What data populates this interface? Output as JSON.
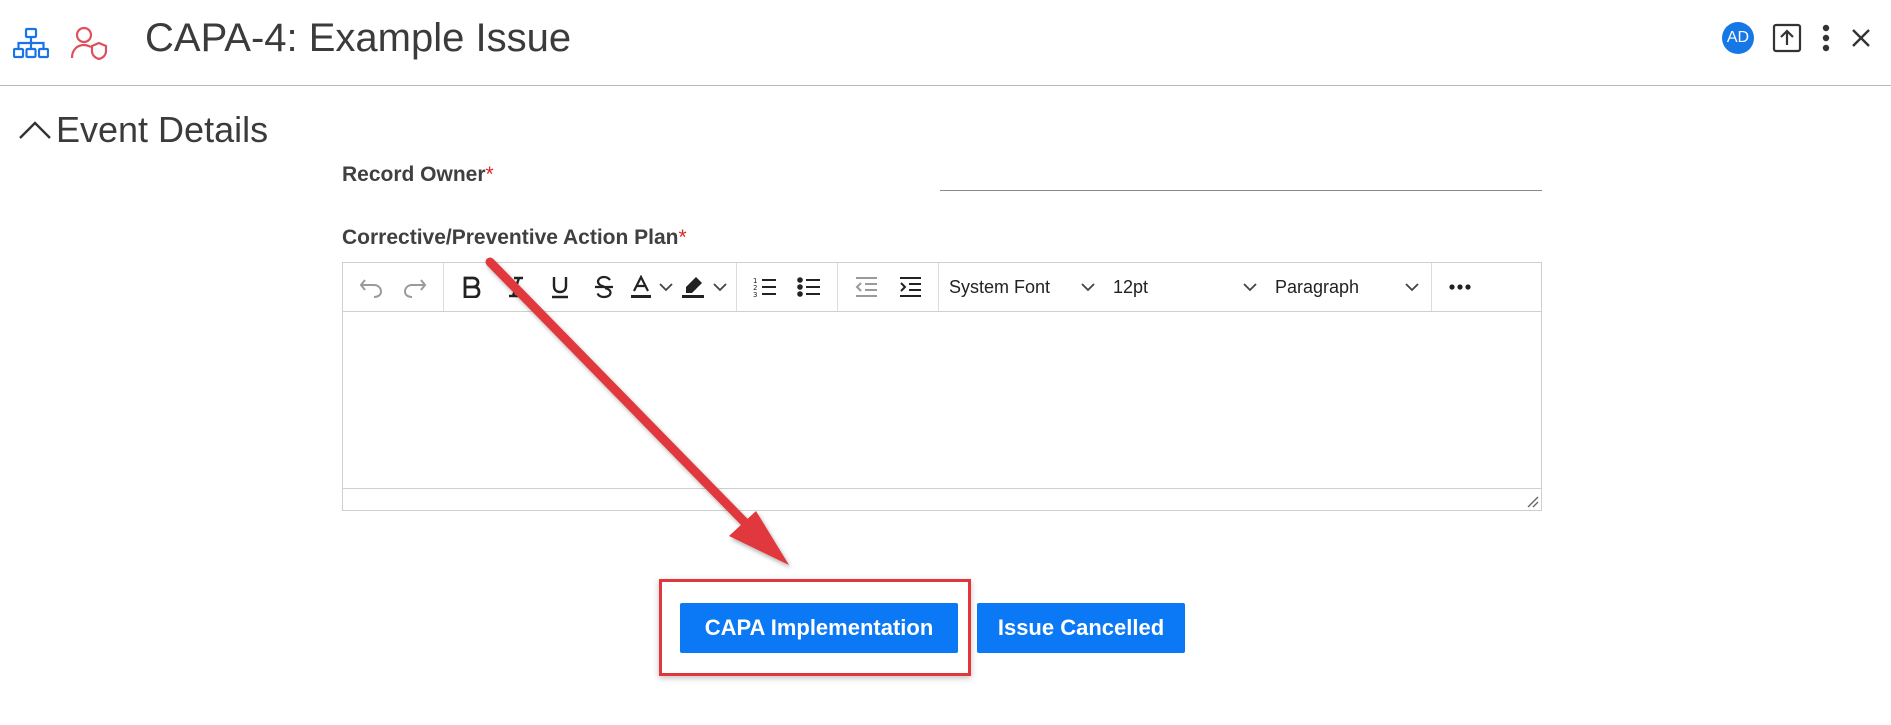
{
  "header": {
    "title": "CAPA-4: Example Issue",
    "avatar_initials": "AD",
    "icons": [
      "hierarchy-icon",
      "user-shield-icon",
      "export-icon",
      "more-vertical-icon",
      "close-icon"
    ]
  },
  "section": {
    "label": "Event Details",
    "expanded": true
  },
  "fields": {
    "record_owner_label": "Record Owner",
    "record_owner_required_mark": "*",
    "action_plan_label": "Corrective/Preventive Action Plan",
    "action_plan_required_mark": "*"
  },
  "editor": {
    "font_family": "System Font",
    "font_size": "12pt",
    "block_format": "Paragraph",
    "content": ""
  },
  "actions": {
    "capa_implementation_label": "CAPA Implementation",
    "issue_cancelled_label": "Issue Cancelled"
  },
  "colors": {
    "accent": "#0b78f5",
    "annotation": "#e0373d",
    "required": "#d9262b"
  }
}
